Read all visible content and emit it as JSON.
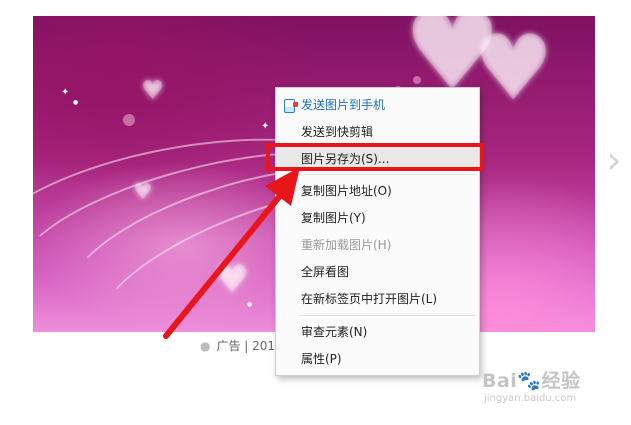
{
  "image": {
    "decor": [
      "heart",
      "heart",
      "heart",
      "heart",
      "heart",
      "sparkle",
      "sparkle",
      "sparkle",
      "sparkle"
    ]
  },
  "caption": {
    "text": "广告 | 2019-"
  },
  "navigation": {
    "next_arrow_glyph": "›"
  },
  "context_menu": {
    "items": [
      {
        "label": "发送图片到手机",
        "icon": "phone-send-icon",
        "enabled": true
      },
      {
        "label": "发送到快剪辑",
        "enabled": true
      },
      {
        "label": "图片另存为(S)...",
        "enabled": true,
        "highlighted": true
      },
      {
        "label": "复制图片地址(O)",
        "enabled": true
      },
      {
        "label": "复制图片(Y)",
        "enabled": true
      },
      {
        "label": "重新加载图片(H)",
        "enabled": false
      },
      {
        "label": "全屏看图",
        "enabled": true
      },
      {
        "label": "在新标签页中打开图片(L)",
        "enabled": true
      },
      {
        "label": "审查元素(N)",
        "enabled": true
      },
      {
        "label": "属性(P)",
        "enabled": true
      }
    ]
  },
  "annotation": {
    "color": "#e8151b",
    "target": "图片另存为(S)..."
  },
  "watermark": {
    "brand": "Bai🐾经验",
    "url": "jingyan.baidu.com"
  },
  "colors": {
    "wallpaper_dark": "#7f1161",
    "wallpaper_light": "#ee8fdc",
    "menu_link": "#1a6fc4",
    "annotation_red": "#e8151b"
  }
}
